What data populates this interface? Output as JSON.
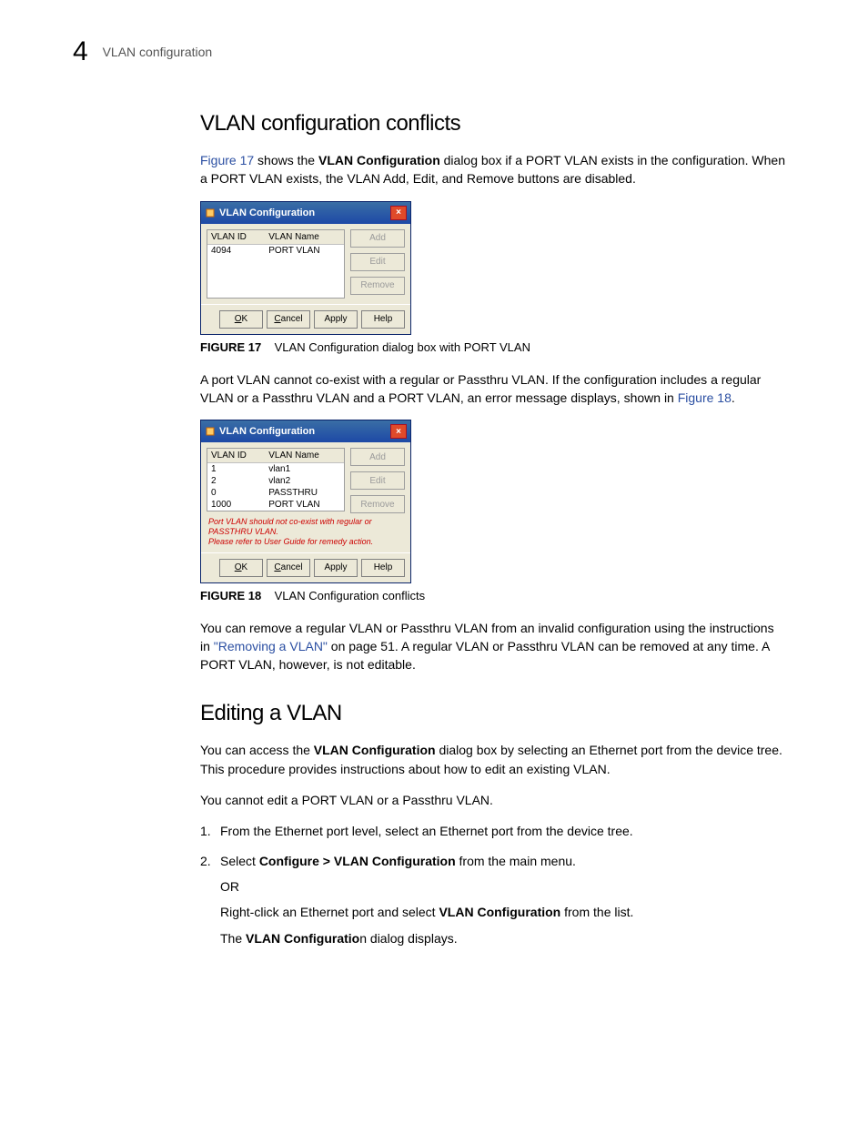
{
  "header": {
    "chapter_number": "4",
    "running": "VLAN configuration"
  },
  "section1": {
    "heading": "VLAN configuration conflicts",
    "para1_a": "Figure 17",
    "para1_b": " shows the ",
    "para1_c": "VLAN Configuration",
    "para1_d": " dialog box if a PORT VLAN exists in the configuration. When a PORT VLAN exists, the VLAN Add, Edit, and Remove buttons are disabled.",
    "fig17_label": "FIGURE 17",
    "fig17_caption": "VLAN Configuration dialog box with PORT VLAN",
    "para2_a": "A port VLAN cannot co-exist with a regular or Passthru VLAN. If the configuration includes a regular VLAN or a Passthru VLAN and a PORT VLAN, an error message displays, shown in ",
    "para2_b": "Figure 18",
    "para2_c": ".",
    "fig18_label": "FIGURE 18",
    "fig18_caption": "VLAN Configuration conflicts",
    "para3_a": "You can remove a regular VLAN or Passthru VLAN from an invalid configuration using the instructions in ",
    "para3_b": "\"Removing a VLAN\"",
    "para3_c": " on page 51. A regular VLAN or Passthru VLAN can be removed at any time. A PORT VLAN, however, is not editable."
  },
  "dlg": {
    "title": "VLAN Configuration",
    "col_id": "VLAN ID",
    "col_name": "VLAN Name",
    "btn_add": "Add",
    "btn_edit": "Edit",
    "btn_remove": "Remove",
    "ok": "OK",
    "cancel": "Cancel",
    "apply": "Apply",
    "help": "Help",
    "fig17_rows": [
      {
        "id": "4094",
        "name": "PORT VLAN"
      }
    ],
    "fig18_rows": [
      {
        "id": "1",
        "name": "vlan1"
      },
      {
        "id": "2",
        "name": "vlan2"
      },
      {
        "id": "0",
        "name": "PASSTHRU"
      },
      {
        "id": "1000",
        "name": "PORT VLAN"
      }
    ],
    "err1": "Port VLAN should not co-exist with regular or PASSTHRU VLAN.",
    "err2": "Please refer to User Guide for remedy action."
  },
  "section2": {
    "heading": "Editing a VLAN",
    "para1_a": "You can access the ",
    "para1_b": "VLAN Configuration",
    "para1_c": " dialog box by selecting an Ethernet port from the device tree. This procedure provides instructions about how to edit an existing VLAN.",
    "para2": "You cannot edit a PORT VLAN or a Passthru VLAN.",
    "step1": "From the Ethernet port level, select an Ethernet port from the device tree.",
    "step2_a": "Select ",
    "step2_b": "Configure > VLAN Configuration",
    "step2_c": " from the main menu.",
    "step2_or": "OR",
    "step2_d": "Right-click an Ethernet port and select ",
    "step2_e": "VLAN Configuration",
    "step2_f": " from the list.",
    "step2_g_a": "The ",
    "step2_g_b": "VLAN Configuratio",
    "step2_g_c": "n dialog displays."
  }
}
